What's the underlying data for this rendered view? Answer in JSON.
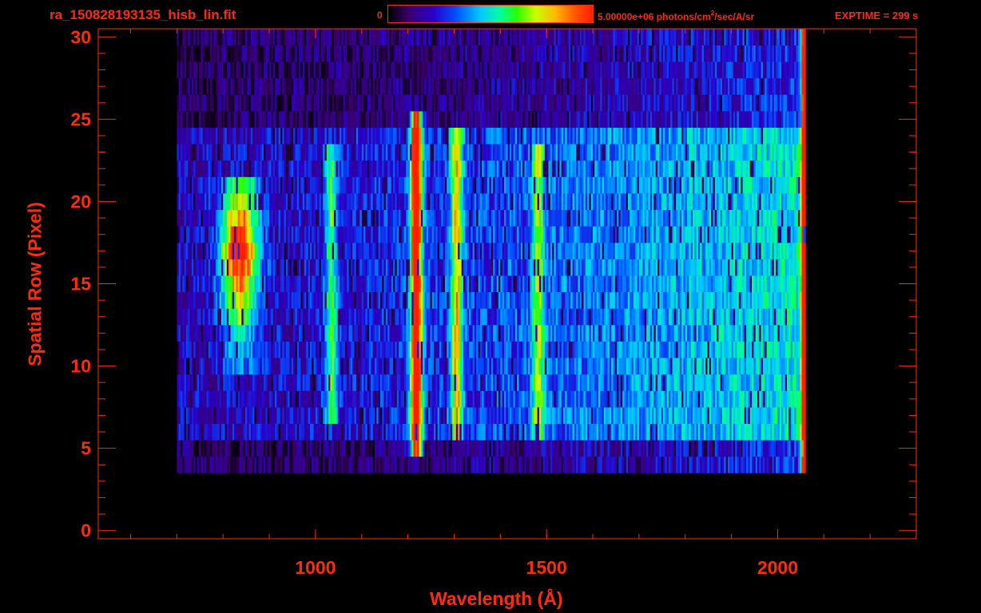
{
  "header": {
    "filename": "ra_150828193135_hisb_lin.fit",
    "colorbar_min": "0",
    "colorbar_max_prefix": "5.00000e+06 photons/cm",
    "colorbar_max_sup": "2",
    "colorbar_max_suffix": "/sec/A/sr",
    "exptime": "EXPTIME = 299 s"
  },
  "colors": {
    "axis": "#ff2a10",
    "background": "#000000"
  },
  "chart_data": {
    "type": "heatmap",
    "title": "ra_150828193135_hisb_lin.fit",
    "xlabel": "Wavelength (Å)",
    "ylabel": "Spatial Row (Pixel)",
    "xlim": [
      530,
      2300
    ],
    "ylim": [
      -0.5,
      30.5
    ],
    "x_ticks": [
      1000,
      1500,
      2000
    ],
    "y_ticks": [
      0,
      5,
      10,
      15,
      20,
      25,
      30
    ],
    "colorscale": {
      "min": 0,
      "max": 5000000,
      "units": "photons/cm^2/sec/A/sr"
    },
    "data_extent": {
      "wavelength": [
        700,
        2060
      ],
      "rows": [
        4,
        30
      ]
    },
    "features": [
      {
        "wavelength": 834,
        "rows": [
          10,
          21
        ],
        "level": "high"
      },
      {
        "wavelength": 1216,
        "rows": [
          5,
          25
        ],
        "level": "high"
      },
      {
        "wavelength": 1304,
        "rows": [
          6,
          24
        ],
        "level": "medium"
      },
      {
        "wavelength": 1032,
        "rows": [
          7,
          23
        ],
        "level": "low"
      },
      {
        "wavelength": 1480,
        "rows": [
          6,
          23
        ],
        "level": "low"
      },
      {
        "wavelength": 2055,
        "rows": [
          1,
          30
        ],
        "level": "high"
      }
    ]
  }
}
